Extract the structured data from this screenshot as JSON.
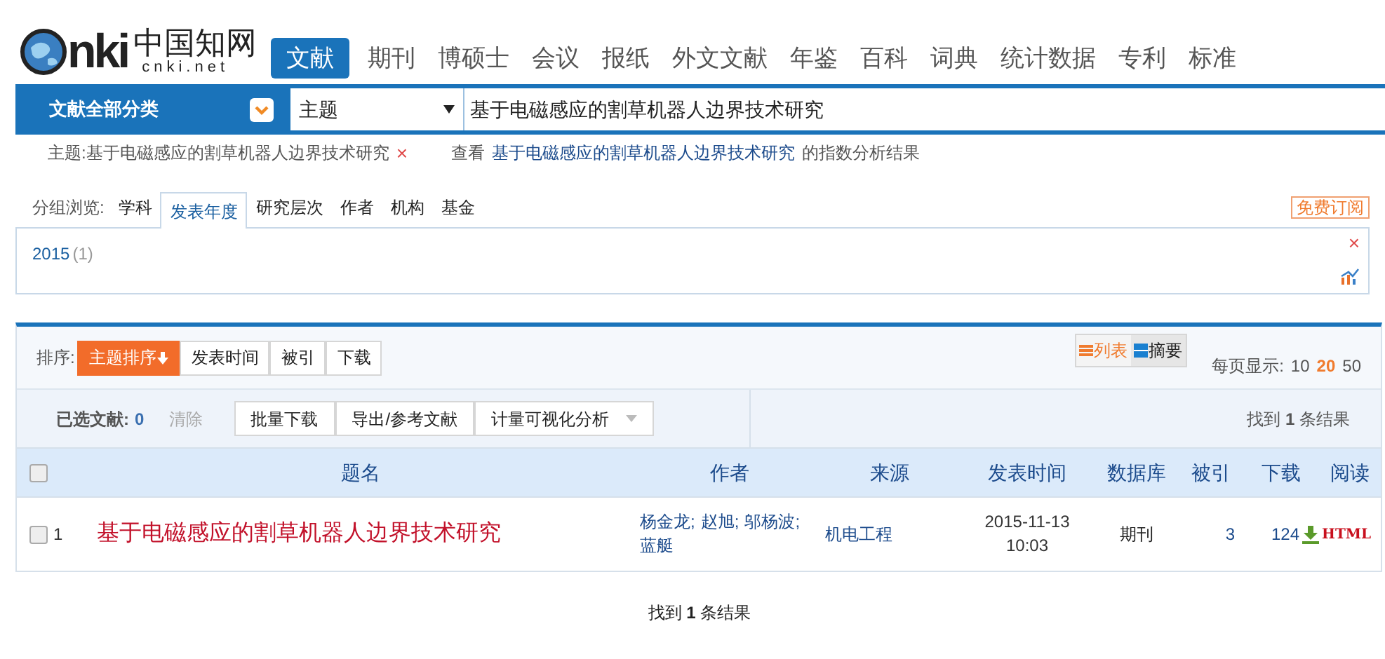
{
  "logo": {
    "letters": "nki",
    "name": "中国知网",
    "domain": "cnki.net"
  },
  "nav_tabs": [
    {
      "label": "文献",
      "selected": true
    },
    {
      "label": "期刊",
      "selected": false
    },
    {
      "label": "博硕士",
      "selected": false
    },
    {
      "label": "会议",
      "selected": false
    },
    {
      "label": "报纸",
      "selected": false
    },
    {
      "label": "外文文献",
      "selected": false
    },
    {
      "label": "年鉴",
      "selected": false
    },
    {
      "label": "百科",
      "selected": false
    },
    {
      "label": "词典",
      "selected": false
    },
    {
      "label": "统计数据",
      "selected": false
    },
    {
      "label": "专利",
      "selected": false
    },
    {
      "label": "标准",
      "selected": false
    }
  ],
  "search": {
    "category": "文献全部分类",
    "field": "主题",
    "value": "基于电磁感应的割草机器人边界技术研究"
  },
  "query_summary": {
    "condition": "主题:基于电磁感应的割草机器人边界技术研究",
    "remove": "×",
    "view_prefix": "查看",
    "view_link": "基于电磁感应的割草机器人边界技术研究",
    "view_suffix": "的指数分析结果"
  },
  "group_browse": {
    "label": "分组浏览:",
    "tabs": [
      {
        "label": "学科",
        "selected": false
      },
      {
        "label": "发表年度",
        "selected": true
      },
      {
        "label": "研究层次",
        "selected": false
      },
      {
        "label": "作者",
        "selected": false
      },
      {
        "label": "机构",
        "selected": false
      },
      {
        "label": "基金",
        "selected": false
      }
    ],
    "subscribe": "免费订阅",
    "years": [
      {
        "year": "2015",
        "count": "(1)"
      }
    ],
    "close": "×"
  },
  "sort": {
    "label": "排序:",
    "options": [
      {
        "label": "主题排序",
        "selected": true
      },
      {
        "label": "发表时间",
        "selected": false
      },
      {
        "label": "被引",
        "selected": false
      },
      {
        "label": "下载",
        "selected": false
      }
    ]
  },
  "view_modes": [
    {
      "label": "列表",
      "selected": true
    },
    {
      "label": "摘要",
      "selected": false
    }
  ],
  "page_size": {
    "label": "每页显示:",
    "options": [
      {
        "label": "10",
        "selected": false
      },
      {
        "label": "20",
        "selected": true
      },
      {
        "label": "50",
        "selected": false
      }
    ]
  },
  "selection": {
    "label": "已选文献:",
    "count": "0",
    "clear": "清除",
    "actions": [
      "批量下载",
      "导出/参考文献",
      "计量可视化分析"
    ],
    "found": "找到 **1** 条结果"
  },
  "table": {
    "all_checked": false,
    "columns": [
      "题名",
      "作者",
      "来源",
      "发表时间",
      "数据库",
      "被引",
      "下载",
      "阅读"
    ],
    "rows": [
      {
        "checked": false,
        "index": "1",
        "title": "基于电磁感应的割草机器人边界技术研究",
        "authors": [
          "杨金龙;",
          "赵旭;",
          "邬杨波;",
          "蓝艇"
        ],
        "source": "机电工程",
        "date": "2015-11-13 10:03",
        "database": "期刊",
        "cited": "3",
        "downloads": "124",
        "read": "HTML"
      }
    ]
  },
  "footer": "找到 **1** 条结果"
}
